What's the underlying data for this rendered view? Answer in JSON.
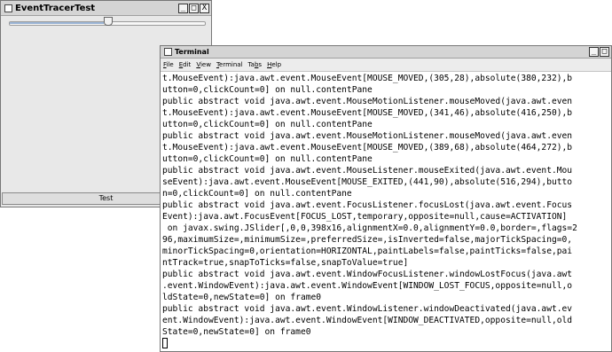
{
  "tracer_window": {
    "title": "EventTracerTest",
    "controls": {
      "minimize": "_",
      "maximize": "□",
      "close": "X"
    },
    "slider": {
      "value_fraction": 0.5
    },
    "test_button_label": "Test"
  },
  "terminal_window": {
    "title": "Terminal",
    "controls": {
      "minimize": "_",
      "maximize": "□"
    },
    "menu": [
      {
        "label": "File",
        "mnemonic": "F",
        "rest": "ile"
      },
      {
        "label": "Edit",
        "mnemonic": "E",
        "rest": "dit"
      },
      {
        "label": "View",
        "mnemonic": "V",
        "rest": "iew"
      },
      {
        "label": "Terminal",
        "mnemonic": "T",
        "rest": "erminal"
      },
      {
        "label": "Tabs",
        "mnemonic": "b",
        "prefix": "Ta",
        "rest": "s"
      },
      {
        "label": "Help",
        "mnemonic": "H",
        "rest": "elp"
      }
    ],
    "lines": [
      "t.MouseEvent):java.awt.event.MouseEvent[MOUSE_MOVED,(305,28),absolute(380,232),b",
      "utton=0,clickCount=0] on null.contentPane",
      "public abstract void java.awt.event.MouseMotionListener.mouseMoved(java.awt.even",
      "t.MouseEvent):java.awt.event.MouseEvent[MOUSE_MOVED,(341,46),absolute(416,250),b",
      "utton=0,clickCount=0] on null.contentPane",
      "public abstract void java.awt.event.MouseMotionListener.mouseMoved(java.awt.even",
      "t.MouseEvent):java.awt.event.MouseEvent[MOUSE_MOVED,(389,68),absolute(464,272),b",
      "utton=0,clickCount=0] on null.contentPane",
      "public abstract void java.awt.event.MouseListener.mouseExited(java.awt.event.Mou",
      "seEvent):java.awt.event.MouseEvent[MOUSE_EXITED,(441,90),absolute(516,294),butto",
      "n=0,clickCount=0] on null.contentPane",
      "public abstract void java.awt.event.FocusListener.focusLost(java.awt.event.Focus",
      "Event):java.awt.FocusEvent[FOCUS_LOST,temporary,opposite=null,cause=ACTIVATION]",
      " on javax.swing.JSlider[,0,0,398x16,alignmentX=0.0,alignmentY=0.0,border=,flags=2",
      "96,maximumSize=,minimumSize=,preferredSize=,isInverted=false,majorTickSpacing=0,",
      "minorTickSpacing=0,orientation=HORIZONTAL,paintLabels=false,paintTicks=false,pai",
      "ntTrack=true,snapToTicks=false,snapToValue=true]",
      "public abstract void java.awt.event.WindowFocusListener.windowLostFocus(java.awt",
      ".event.WindowEvent):java.awt.event.WindowEvent[WINDOW_LOST_FOCUS,opposite=null,o",
      "ldState=0,newState=0] on frame0",
      "public abstract void java.awt.event.WindowListener.windowDeactivated(java.awt.ev",
      "ent.WindowEvent):java.awt.event.WindowEvent[WINDOW_DEACTIVATED,opposite=null,old",
      "State=0,newState=0] on frame0"
    ]
  }
}
